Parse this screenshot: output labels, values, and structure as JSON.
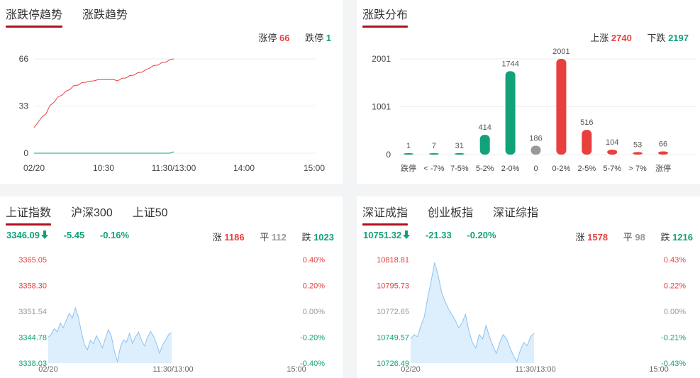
{
  "trend_panel": {
    "tabs": [
      "涨跌停趋势",
      "涨跌趋势"
    ],
    "limit_up_label": "涨停",
    "limit_up_value": "66",
    "limit_down_label": "跌停",
    "limit_down_value": "1",
    "y_ticks": [
      "66",
      "33",
      "0"
    ],
    "x_ticks": [
      "02/20",
      "10:30",
      "11:30/13:00",
      "14:00",
      "15:00"
    ],
    "colors": {
      "up": "#e8403f",
      "down": "#11a27a"
    }
  },
  "dist_panel": {
    "tab": "涨跌分布",
    "up_label": "上涨",
    "up_value": "2740",
    "down_label": "下跌",
    "down_value": "2197",
    "y_ticks": [
      "2001",
      "1001",
      "0"
    ]
  },
  "sh_panel": {
    "tabs": [
      "上证指数",
      "沪深300",
      "上证50"
    ],
    "price": "3346.09",
    "change": "-5.45",
    "change_pct": "-0.16%",
    "up_label": "涨",
    "up_count": "1186",
    "flat_label": "平",
    "flat_count": "112",
    "down_label": "跌",
    "down_count": "1023",
    "y_left": [
      "3365.05",
      "3358.30",
      "3351.54",
      "3344.78",
      "3338.03"
    ],
    "y_right": [
      "0.40%",
      "0.20%",
      "0.00%",
      "-0.20%",
      "-0.40%"
    ],
    "x_ticks": [
      "02/20",
      "11:30/13:00",
      "15:00"
    ]
  },
  "sz_panel": {
    "tabs": [
      "深证成指",
      "创业板指",
      "深证综指"
    ],
    "price": "10751.32",
    "change": "-21.33",
    "change_pct": "-0.20%",
    "up_label": "涨",
    "up_count": "1578",
    "flat_label": "平",
    "flat_count": "98",
    "down_label": "跌",
    "down_count": "1216",
    "y_left": [
      "10818.81",
      "10795.73",
      "10772.65",
      "10749.57",
      "10726.49"
    ],
    "y_right": [
      "0.43%",
      "0.22%",
      "0.00%",
      "-0.21%",
      "-0.43%"
    ],
    "x_ticks": [
      "02/20",
      "11:30/13:00",
      "15:00"
    ]
  },
  "chart_data": [
    {
      "type": "line",
      "xlabel": "",
      "ylabel": "",
      "ylim": [
        0,
        66
      ],
      "series": [
        {
          "name": "涨停",
          "values": [
            18,
            22,
            25,
            28,
            33,
            36,
            39,
            41,
            43,
            45,
            47,
            48,
            49,
            50,
            50,
            51,
            51,
            52,
            51,
            52,
            51,
            51,
            52,
            53,
            54,
            55,
            56,
            57,
            58,
            60,
            61,
            62,
            63,
            64,
            65,
            66
          ]
        },
        {
          "name": "跌停",
          "values": [
            0,
            0,
            0,
            0,
            0,
            0,
            0,
            0,
            0,
            0,
            0,
            0,
            0,
            0,
            0,
            0,
            0,
            0,
            0,
            0,
            0,
            0,
            0,
            0,
            0,
            0,
            0,
            0,
            0,
            0,
            0,
            0,
            0,
            0,
            0,
            1
          ]
        }
      ]
    },
    {
      "type": "bar",
      "categories": [
        "跌停",
        "< -7%",
        "7-5%",
        "5-2%",
        "2-0%",
        "0",
        "0-2%",
        "2-5%",
        "5-7%",
        "> 7%",
        "涨停"
      ],
      "values": [
        1,
        7,
        31,
        414,
        1744,
        186,
        2001,
        516,
        104,
        53,
        66
      ],
      "bar_colors": [
        "#11a27a",
        "#11a27a",
        "#11a27a",
        "#11a27a",
        "#11a27a",
        "#999999",
        "#e8403f",
        "#e8403f",
        "#e8403f",
        "#e8403f",
        "#e8403f"
      ],
      "ylim": [
        0,
        2001
      ]
    },
    {
      "type": "area",
      "ylim": [
        3338.03,
        3365.05
      ],
      "values": [
        3344.8,
        3345.5,
        3347.0,
        3346.2,
        3348.5,
        3347.3,
        3349.2,
        3351.0,
        3349.8,
        3352.5,
        3350.1,
        3346.2,
        3343.0,
        3341.5,
        3344.0,
        3343.1,
        3345.2,
        3343.8,
        3342.0,
        3344.5,
        3346.8,
        3345.0,
        3341.0,
        3338.5,
        3342.3,
        3344.1,
        3343.5,
        3345.8,
        3343.2,
        3344.9,
        3346.1,
        3344.0,
        3342.5,
        3344.8,
        3346.3,
        3345.1,
        3343.0,
        3340.6,
        3342.8,
        3344.0,
        3345.5,
        3346.0
      ]
    },
    {
      "type": "area",
      "ylim": [
        10726.49,
        10818.81
      ],
      "values": [
        10748,
        10752,
        10750,
        10760,
        10768,
        10785,
        10800,
        10816,
        10805,
        10790,
        10782,
        10775,
        10770,
        10765,
        10758,
        10762,
        10770,
        10755,
        10745,
        10740,
        10752,
        10748,
        10760,
        10750,
        10742,
        10735,
        10745,
        10752,
        10748,
        10740,
        10733,
        10728,
        10738,
        10745,
        10742,
        10750,
        10753
      ]
    }
  ]
}
